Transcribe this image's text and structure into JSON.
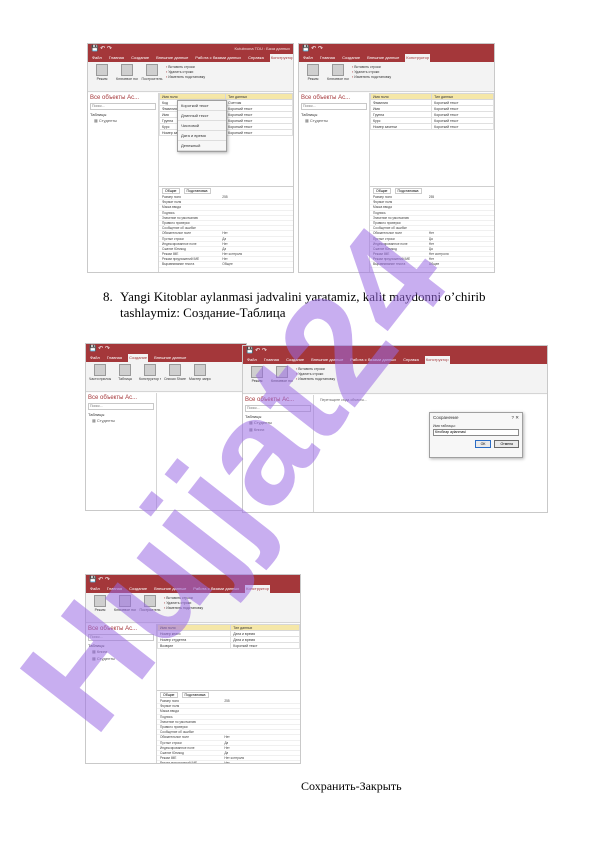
{
  "step": {
    "number": "8.",
    "text": "Yangi Kitoblar aylanmasi jadvalini yaratamiz, kalit maydonni o’chirib tashlaymiz: Создание-Таблица"
  },
  "footer_caption": "Сохранить-Закрыть",
  "watermark": {
    "text": "Hujjat24",
    "color": "#9b6be3"
  },
  "access": {
    "brand_color": "#a4373a",
    "ribbon_tabs": [
      "Файл",
      "Главная",
      "Создание",
      "Внешние данные",
      "Работа с базами данных",
      "Справка",
      "Конструктор"
    ],
    "nav_header": "Все объекты Ac...",
    "nav_search": "Поиск...",
    "nav_group": "Таблицы",
    "nav_item_students": "Студенты",
    "nav_item_books": "Книги",
    "home_buttons": [
      "Режим",
      "Ключевое поле",
      "Построитель",
      "Проверить правила"
    ],
    "row_tools": [
      "Вставить строки",
      "Удалить строки",
      "Изменить подстановку"
    ],
    "create_buttons": [
      "Части приложения",
      "Таблица",
      "Конструктор таблиц",
      "Списки SharePoint",
      "Мастер запросов",
      "Конструктор запросов"
    ],
    "grid_headers": [
      "Имя поля",
      "Тип данных"
    ],
    "fields_1": [
      [
        "Код",
        "Счетчик"
      ],
      [
        "Фамилия",
        "Короткий текст"
      ],
      [
        "Имя",
        "Короткий текст"
      ],
      [
        "Группа",
        "Короткий текст"
      ],
      [
        "Курс",
        "Короткий текст"
      ],
      [
        "Номер зачетки",
        "Короткий текст"
      ]
    ],
    "type_menu": [
      "Короткий текст",
      "Длинный текст",
      "Числовой",
      "Дата и время",
      "Денежный"
    ],
    "fields_3": [
      [
        "Номер книги",
        "Дата и время"
      ],
      [
        "Номер студента",
        "Дата и время"
      ],
      [
        "Возврат",
        "Короткий текст"
      ]
    ],
    "prop_tabs": [
      "Общие",
      "Подстановка"
    ],
    "properties": [
      [
        "Размер поля",
        "255"
      ],
      [
        "Формат поля",
        ""
      ],
      [
        "Маска ввода",
        ""
      ],
      [
        "Подпись",
        ""
      ],
      [
        "Значение по умолчанию",
        ""
      ],
      [
        "Правило проверки",
        ""
      ],
      [
        "Сообщение об ошибке",
        ""
      ],
      [
        "Обязательное поле",
        "Нет"
      ],
      [
        "Пустые строки",
        "Да"
      ],
      [
        "Индексированное поле",
        "Нет"
      ],
      [
        "Сжатие Юникод",
        "Да"
      ],
      [
        "Режим IME",
        "Нет контроля"
      ],
      [
        "Режим предложений IME",
        "Нет"
      ],
      [
        "Выравнивание текста",
        "Общее"
      ]
    ],
    "save_dialog": {
      "title": "Сохранение",
      "field_label": "Имя таблицы:",
      "value": "Кітоблар аylanmasi",
      "ok": "ОК",
      "cancel": "Отмена"
    },
    "popup_message": "Перетащите сюда объекты...",
    "window_title": "Kutubxona TDU : База данных"
  }
}
